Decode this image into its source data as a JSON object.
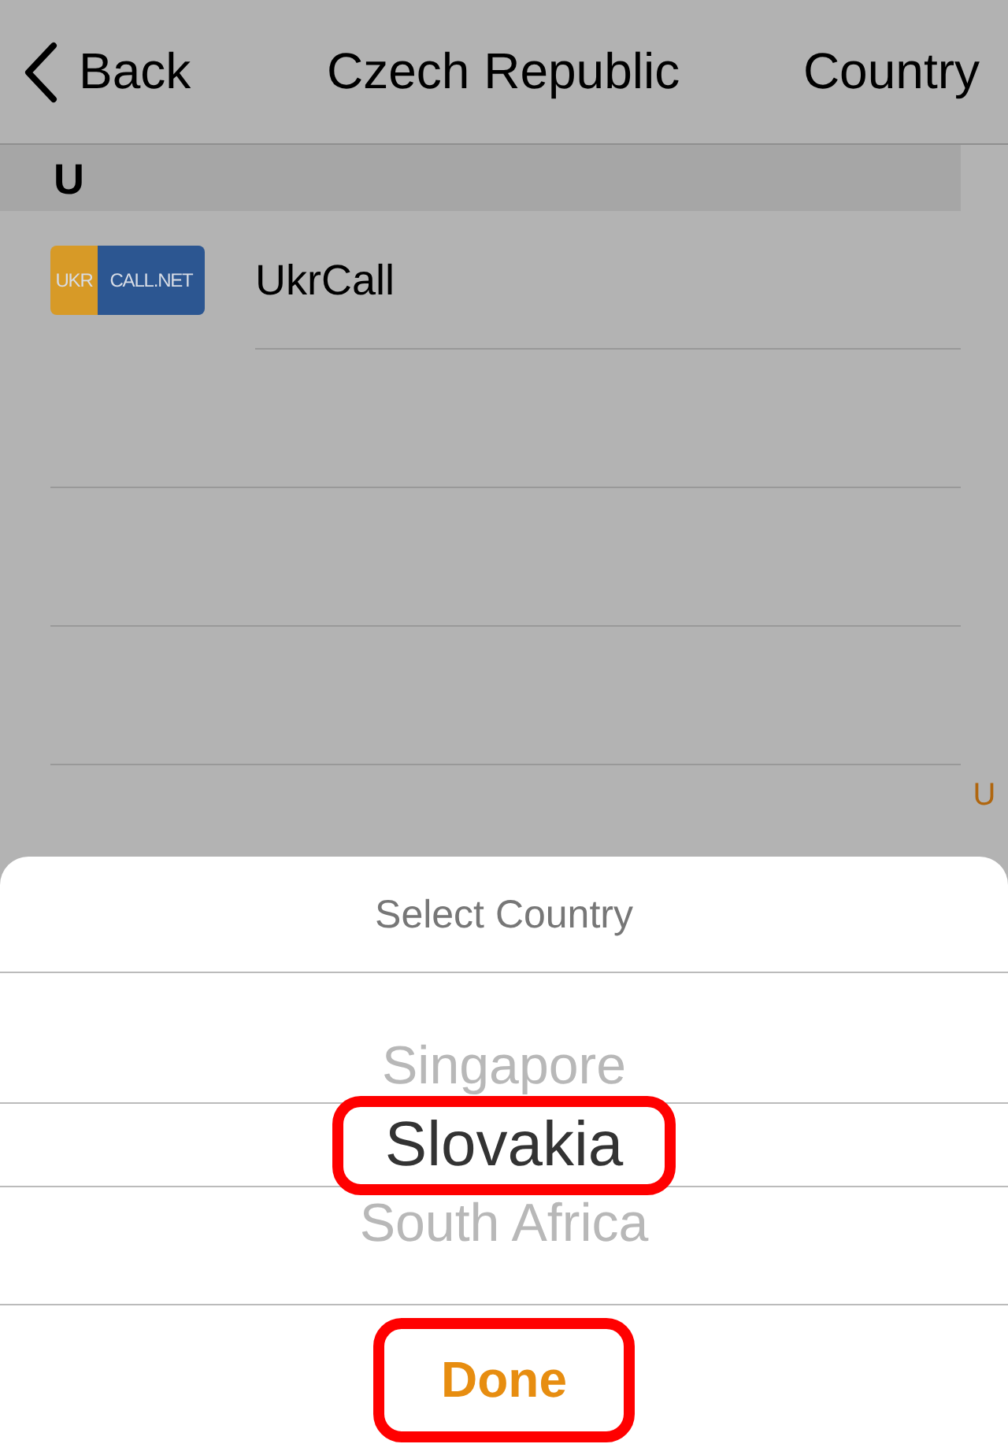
{
  "nav": {
    "back": "Back",
    "title": "Czech Republic",
    "right": "Country"
  },
  "sections": [
    {
      "header": "U",
      "rows": [
        {
          "logo": {
            "left": "UKR",
            "right": "CALL.NET"
          },
          "name": "UkrCall"
        }
      ]
    }
  ],
  "index": [
    "U"
  ],
  "picker": {
    "title": "Select Country",
    "options": [
      {
        "label": "Singapore",
        "selected": false,
        "highlighted": false
      },
      {
        "label": "Slovakia",
        "selected": true,
        "highlighted": true
      },
      {
        "label": "South Africa",
        "selected": false,
        "highlighted": false
      }
    ],
    "done": {
      "label": "Done",
      "highlighted": true
    }
  }
}
